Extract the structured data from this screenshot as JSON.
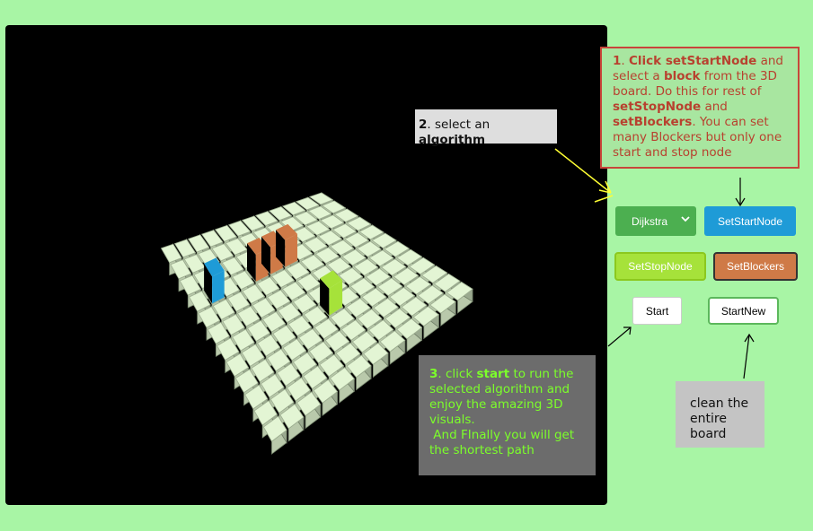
{
  "colors": {
    "page_bg": "#a8f5a5",
    "viewport_bg": "#000000",
    "tile": "#e3f5d4",
    "start_block": "#1e9bd7",
    "stop_block": "#a6e23a",
    "blocker_block": "#cf7a47"
  },
  "instructions": {
    "step1": {
      "num": "1",
      "p1": ". ",
      "click_start": "Click setStartNode",
      "p2": " and select a ",
      "block": "block",
      "p3": " from the 3D board. Do this for rest of ",
      "stop": "setStopNode",
      "p4": " and ",
      "blockers": "setBlockers",
      "p5": ". You can set many Blockers but only one start and stop node"
    },
    "step2": {
      "num": "2",
      "p1": ". select an ",
      "algorithm": "algorithm"
    },
    "step3": {
      "num": "3",
      "p1": ". click ",
      "start": "start",
      "p2": " to run the selected algorithm and enjoy the amazing 3D visuals.",
      "p3": " And FInally you will get the shortest path"
    },
    "clean": "clean the entire board"
  },
  "controls": {
    "algorithm_selected": "Dijkstra",
    "set_start_node": "SetStartNode",
    "set_stop_node": "SetStopNode",
    "set_blockers": "SetBlockers",
    "start": "Start",
    "start_new": "StartNew"
  },
  "board": {
    "grid_size": 12,
    "start_cell": [
      1,
      3
    ],
    "stop_cell": [
      6,
      7
    ],
    "blocker_cells": [
      [
        4,
        3
      ],
      [
        5,
        3
      ],
      [
        6,
        3
      ]
    ]
  }
}
